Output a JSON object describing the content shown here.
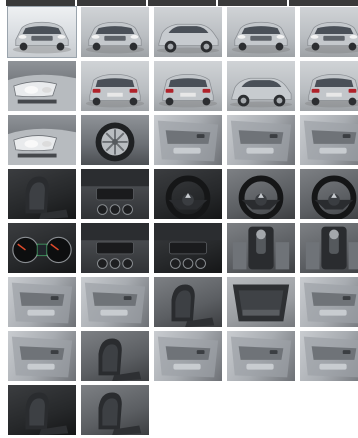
{
  "gallery": {
    "photos": [
      {
        "name": "photo-front-three-quarter",
        "kind": "ext-front",
        "bg": "ext-light",
        "selected": true
      },
      {
        "name": "photo-front",
        "kind": "ext-front",
        "bg": "ext-studio"
      },
      {
        "name": "photo-front-side",
        "kind": "ext-side",
        "bg": "ext-studio"
      },
      {
        "name": "photo-front-angle",
        "kind": "ext-front",
        "bg": "ext-studio"
      },
      {
        "name": "photo-front-right",
        "kind": "ext-front",
        "bg": "ext-studio"
      },
      {
        "name": "photo-headlight",
        "kind": "ext-detail",
        "bg": "ext-dark"
      },
      {
        "name": "photo-rear-three-quarter",
        "kind": "ext-rear",
        "bg": "ext-studio"
      },
      {
        "name": "photo-rear",
        "kind": "ext-rear",
        "bg": "ext-studio"
      },
      {
        "name": "photo-rear-side",
        "kind": "ext-side",
        "bg": "ext-studio"
      },
      {
        "name": "photo-rear-right",
        "kind": "ext-rear",
        "bg": "ext-studio"
      },
      {
        "name": "photo-tail-light",
        "kind": "ext-detail",
        "bg": "ext-dark"
      },
      {
        "name": "photo-wheel",
        "kind": "wheel",
        "bg": "ext-dark"
      },
      {
        "name": "photo-door-panel",
        "kind": "door",
        "bg": "door"
      },
      {
        "name": "photo-door-trim",
        "kind": "door",
        "bg": "door"
      },
      {
        "name": "photo-window-switches",
        "kind": "door",
        "bg": "door"
      },
      {
        "name": "photo-driver-seat",
        "kind": "seat",
        "bg": "int-dark"
      },
      {
        "name": "photo-dashboard",
        "kind": "dash",
        "bg": "dash"
      },
      {
        "name": "photo-steering-wheel",
        "kind": "wheel-steer",
        "bg": "int-dark"
      },
      {
        "name": "photo-steering-controls",
        "kind": "wheel-steer",
        "bg": "int-mid"
      },
      {
        "name": "photo-steering-buttons",
        "kind": "wheel-steer",
        "bg": "int-mid"
      },
      {
        "name": "photo-instrument-cluster",
        "kind": "gauges",
        "bg": "int-dark"
      },
      {
        "name": "photo-climate-controls",
        "kind": "dash",
        "bg": "dash"
      },
      {
        "name": "photo-center-console",
        "kind": "dash",
        "bg": "int-dark"
      },
      {
        "name": "photo-gear-shifter",
        "kind": "console",
        "bg": "int-mid"
      },
      {
        "name": "photo-console-storage",
        "kind": "console",
        "bg": "int-mid"
      },
      {
        "name": "photo-rear-door-open",
        "kind": "door",
        "bg": "door"
      },
      {
        "name": "photo-rear-door-panel",
        "kind": "door",
        "bg": "door"
      },
      {
        "name": "photo-rear-seats",
        "kind": "seat",
        "bg": "int-mid"
      },
      {
        "name": "photo-cargo-area",
        "kind": "cargo",
        "bg": "int-light"
      },
      {
        "name": "photo-third-row",
        "kind": "door",
        "bg": "door"
      },
      {
        "name": "photo-front-door-open",
        "kind": "door",
        "bg": "door"
      },
      {
        "name": "photo-passenger-seat",
        "kind": "seat",
        "bg": "int-mid"
      },
      {
        "name": "photo-rear-door-inner",
        "kind": "door",
        "bg": "door"
      },
      {
        "name": "photo-door-handle",
        "kind": "door",
        "bg": "door"
      },
      {
        "name": "photo-sill",
        "kind": "door",
        "bg": "door"
      },
      {
        "name": "photo-seat-detail",
        "kind": "seat",
        "bg": "int-dark"
      },
      {
        "name": "photo-rear-bench",
        "kind": "seat",
        "bg": "int-mid"
      }
    ]
  }
}
